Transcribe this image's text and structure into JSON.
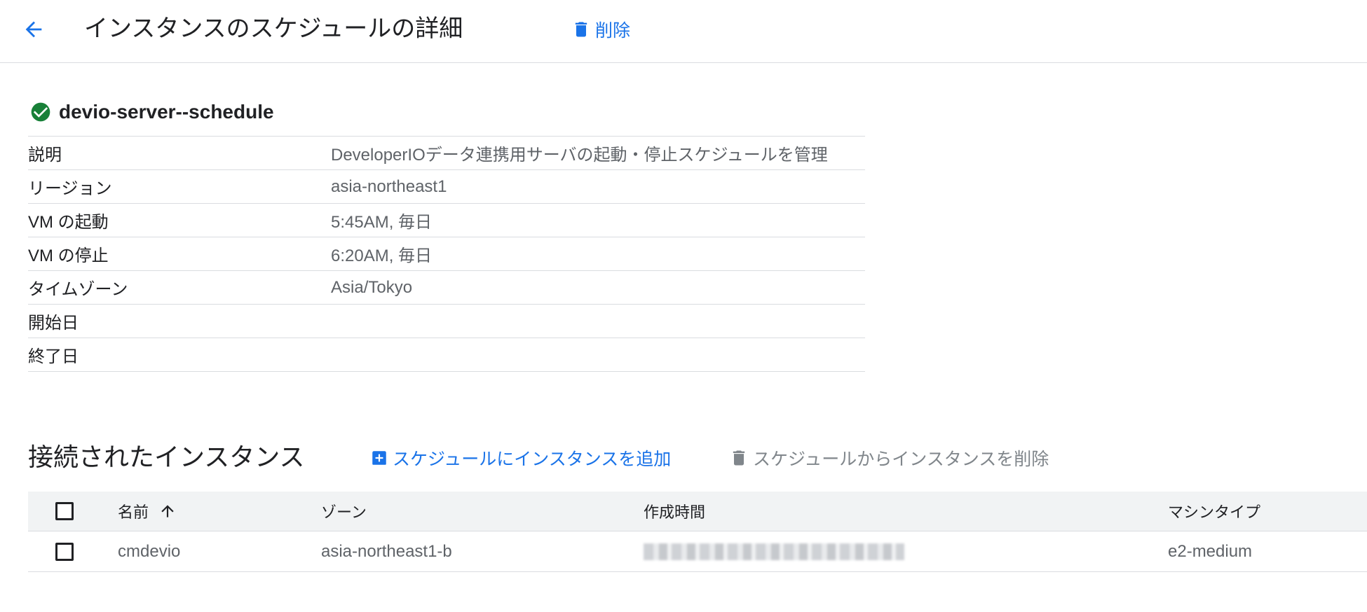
{
  "header": {
    "title": "インスタンスのスケジュールの詳細",
    "delete_label": "削除"
  },
  "schedule": {
    "name": "devio-server--schedule",
    "status_icon": "check-circle-icon",
    "status_color": "#188038"
  },
  "details": [
    {
      "label": "説明",
      "value": "DeveloperIOデータ連携用サーバの起動・停止スケジュールを管理"
    },
    {
      "label": "リージョン",
      "value": "asia-northeast1"
    },
    {
      "label": "VM の起動",
      "value": "5:45AM, 毎日"
    },
    {
      "label": "VM の停止",
      "value": "6:20AM, 毎日"
    },
    {
      "label": "タイムゾーン",
      "value": "Asia/Tokyo"
    },
    {
      "label": "開始日",
      "value": ""
    },
    {
      "label": "終了日",
      "value": ""
    }
  ],
  "instances": {
    "title": "接続されたインスタンス",
    "add_label": "スケジュールにインスタンスを追加",
    "remove_label": "スケジュールからインスタンスを削除",
    "columns": {
      "name": "名前",
      "zone": "ゾーン",
      "created": "作成時間",
      "machine_type": "マシンタイプ"
    },
    "rows": [
      {
        "name": "cmdevio",
        "zone": "asia-northeast1-b",
        "machine_type": "e2-medium"
      }
    ]
  },
  "colors": {
    "accent": "#1a73e8",
    "text": "#202124",
    "muted": "#5f6368",
    "disabled": "#80868b",
    "divider": "#dadce0"
  }
}
